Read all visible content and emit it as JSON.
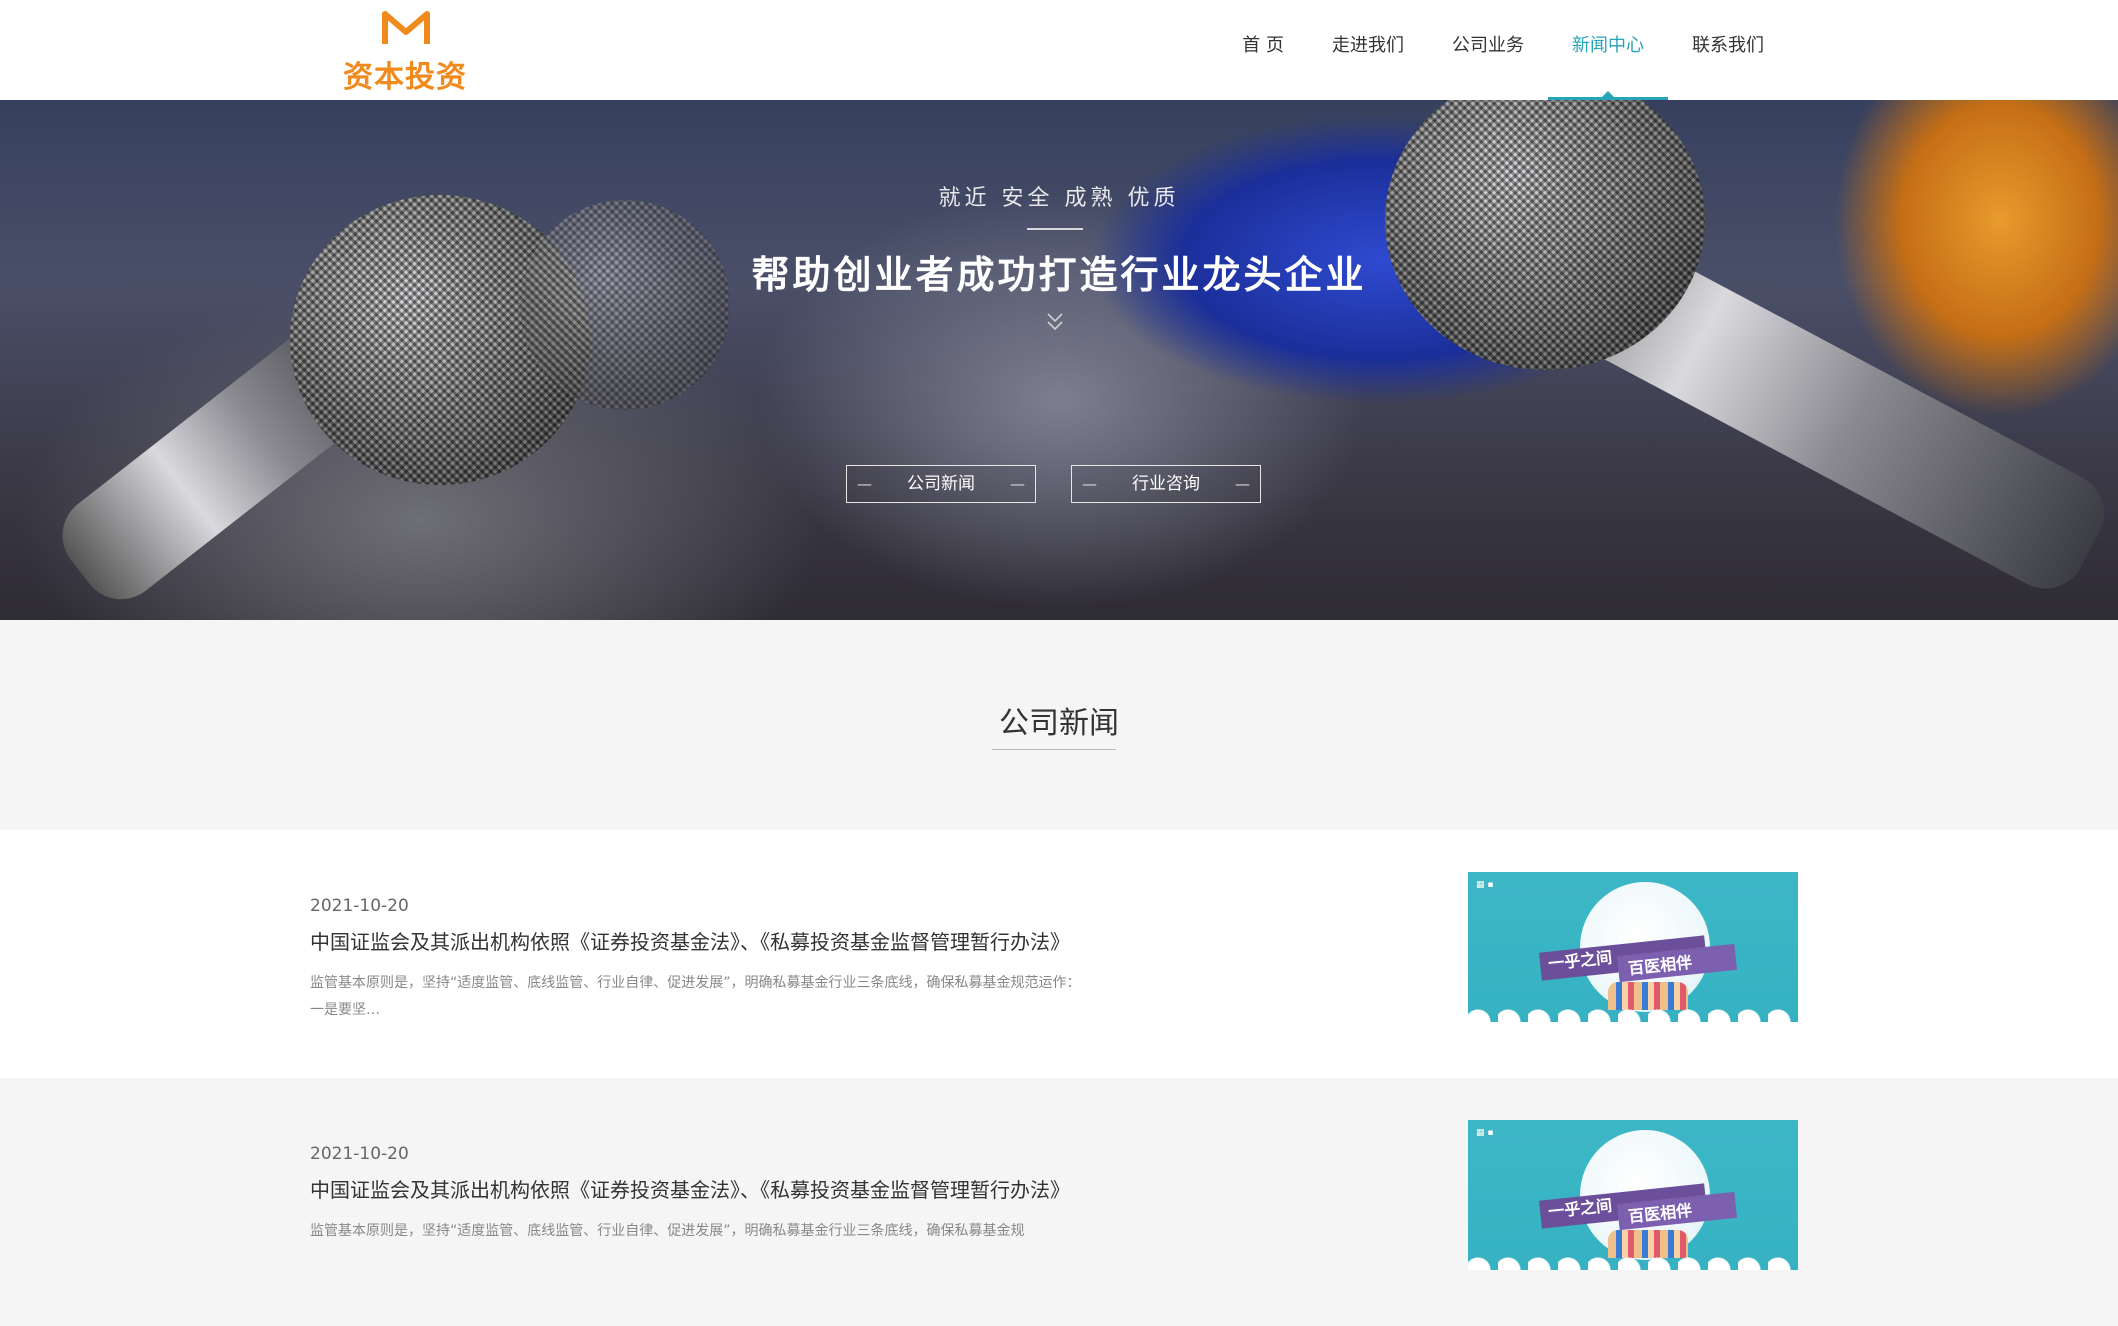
{
  "header": {
    "logo_text": "资本投资",
    "nav": [
      "首 页",
      "走进我们",
      "公司业务",
      "新闻中心",
      "联系我们"
    ],
    "active_nav": "新闻中心"
  },
  "banner": {
    "subtitle": "就近 安全 成熟 优质",
    "title": "帮助创业者成功打造行业龙头企业",
    "buttons": [
      "公司新闻",
      "行业咨询"
    ]
  },
  "section": {
    "title": "公司新闻"
  },
  "news": [
    {
      "date": "2021-10-20",
      "title": "中国证监会及其派出机构依照《证券投资基金法》、《私募投资基金监督管理暂行办法》",
      "desc": "监管基本原则是，坚持“适度监管、底线监管、行业自律、促进发展”，明确私募基金行业三条底线，确保私募基金规范运作：一是要坚…",
      "thumb_text_left": "一乎之间",
      "thumb_text_right": "百医相伴"
    },
    {
      "date": "2021-10-20",
      "title": "中国证监会及其派出机构依照《证券投资基金法》、《私募投资基金监督管理暂行办法》",
      "desc": "监管基本原则是，坚持“适度监管、底线监管、行业自律、促进发展”，明确私募基金行业三条底线，确保私募基金规",
      "thumb_text_left": "一乎之间",
      "thumb_text_right": "百医相伴"
    }
  ],
  "colors": {
    "accent": "#27a4b8",
    "logo": "#f08a1d",
    "section_bg": "#f5f5f5"
  }
}
